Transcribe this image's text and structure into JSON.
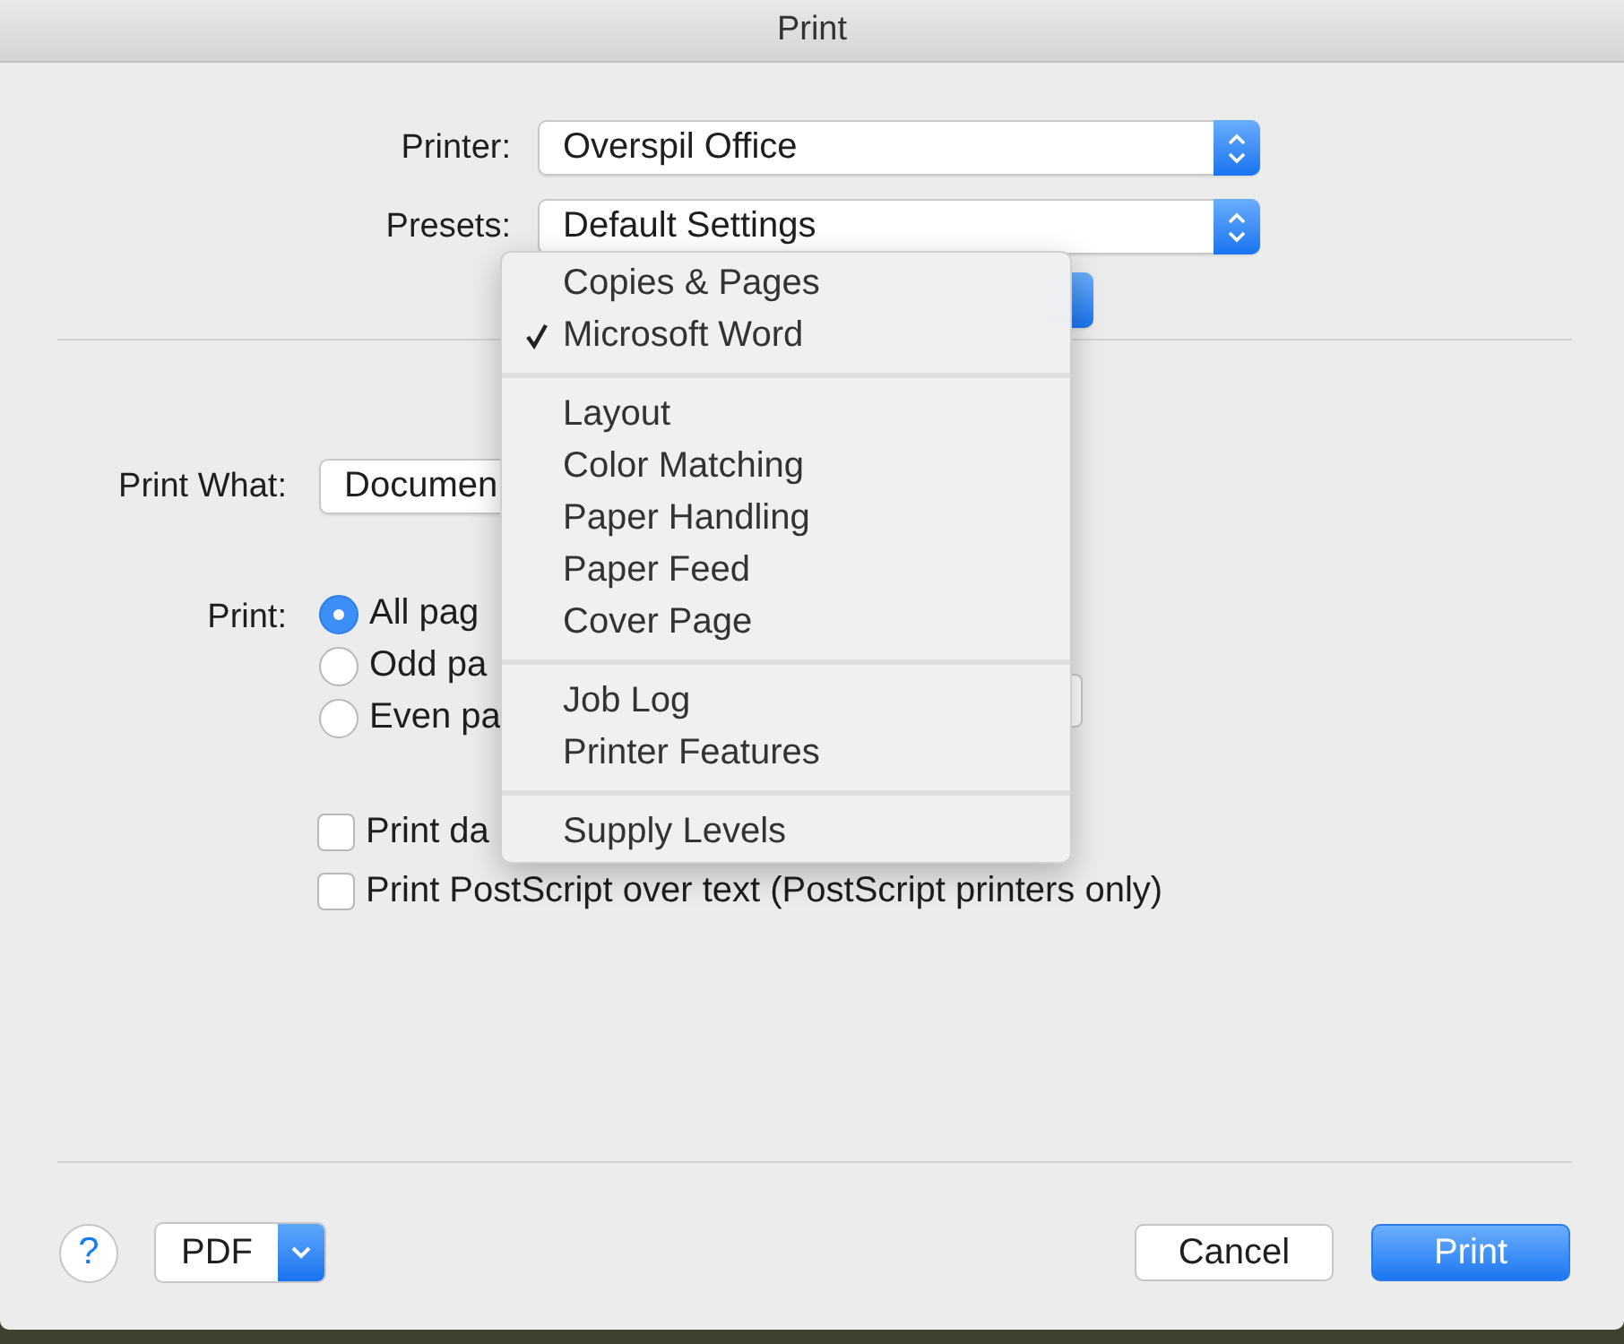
{
  "window": {
    "title": "Print"
  },
  "printer": {
    "label": "Printer:",
    "value": "Overspil Office"
  },
  "presets": {
    "label": "Presets:",
    "value": "Default Settings"
  },
  "print_what": {
    "label": "Print What:",
    "value": "Documen"
  },
  "print_range": {
    "label": "Print:",
    "options": [
      {
        "label": "All pag",
        "selected": true
      },
      {
        "label": "Odd pa",
        "selected": false
      },
      {
        "label": "Even pa",
        "selected": false
      }
    ]
  },
  "options": [
    {
      "label": "Print da",
      "checked": false
    },
    {
      "label": "Print PostScript over text (PostScript printers only)",
      "checked": false
    }
  ],
  "panel_menu": {
    "groups": [
      [
        {
          "label": "Copies & Pages",
          "checked": false
        },
        {
          "label": "Microsoft Word",
          "checked": true
        }
      ],
      [
        {
          "label": "Layout",
          "checked": false
        },
        {
          "label": "Color Matching",
          "checked": false
        },
        {
          "label": "Paper Handling",
          "checked": false
        },
        {
          "label": "Paper Feed",
          "checked": false
        },
        {
          "label": "Cover Page",
          "checked": false
        }
      ],
      [
        {
          "label": "Job Log",
          "checked": false
        },
        {
          "label": "Printer Features",
          "checked": false
        }
      ],
      [
        {
          "label": "Supply Levels",
          "checked": false
        }
      ]
    ]
  },
  "footer": {
    "help": "?",
    "pdf": "PDF",
    "buttons": [
      {
        "label": "Cancel",
        "kind": "secondary"
      },
      {
        "label": "Print",
        "kind": "default"
      }
    ]
  }
}
